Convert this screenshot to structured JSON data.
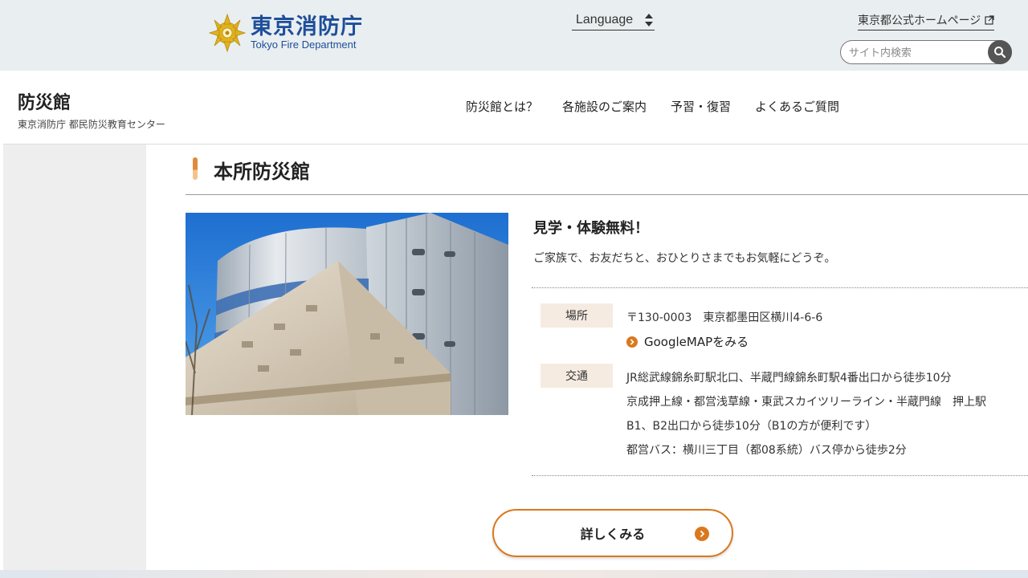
{
  "top": {
    "logo_ja": "東京消防庁",
    "logo_en": "Tokyo Fire Department",
    "language_label": "Language",
    "official_link": "東京都公式ホームページ",
    "search_placeholder": "サイト内検索"
  },
  "header": {
    "site_name": "防災館",
    "site_sub": "東京消防庁 都民防災教育センター",
    "nav": [
      "防災館とは？",
      "各施設のご案内",
      "予習・復習",
      "よくあるご質問"
    ]
  },
  "section": {
    "title": "本所防災館",
    "headline": "見学・体験無料！",
    "lead": "ご家族で、お友だちと、おひとりさまでもお気軽にどうぞ。",
    "place_label": "場所",
    "address": "〒130-0003　東京都墨田区横川4-6-6",
    "map_link": "GoogleMAPをみる",
    "access_label": "交通",
    "access_lines": [
      "JR総武線錦糸町駅北口、半蔵門線錦糸町駅4番出口から徒歩10分",
      "京成押上線・都営浅草線・東武スカイツリーライン・半蔵門線　押上駅",
      "B1、B2出口から徒歩10分（B1の方が便利です）",
      "都営バス：横川三丁目（都08系統）バス停から徒歩2分"
    ],
    "more_button": "詳しくみる"
  },
  "colors": {
    "accent": "#d9791e",
    "brand_blue": "#1d4e9a",
    "tag_bg": "#f5ebe1"
  }
}
